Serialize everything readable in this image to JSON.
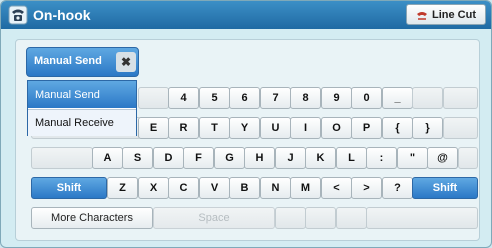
{
  "titlebar": {
    "title": "On-hook",
    "icon": "telephone-icon",
    "line_cut_label": "Line Cut",
    "line_cut_icon": "line-cut-icon"
  },
  "mode_button": {
    "label": "Manual Send",
    "close_icon": "close-icon",
    "close_glyph": "✖"
  },
  "dropdown": {
    "options": [
      "Manual Send",
      "Manual Receive"
    ],
    "selected": "Manual Send"
  },
  "keyboard": {
    "row1": [
      "4",
      "5",
      "6",
      "7",
      "8",
      "9",
      "0",
      "_"
    ],
    "row2": [
      "E",
      "R",
      "T",
      "Y",
      "U",
      "I",
      "O",
      "P",
      "{",
      "}"
    ],
    "row3": [
      "A",
      "S",
      "D",
      "F",
      "G",
      "H",
      "J",
      "K",
      "L",
      ":",
      "\"",
      "@"
    ],
    "row4": [
      "Z",
      "X",
      "C",
      "V",
      "B",
      "N",
      "M",
      "<",
      ">",
      "?"
    ],
    "shift_left": "Shift",
    "shift_right": "Shift",
    "more_characters": "More Characters",
    "space": "Space"
  },
  "colors": {
    "title_bar": "#2a7db8",
    "selected_blue": "#3b8ad1",
    "background": "#d3ecf2"
  }
}
